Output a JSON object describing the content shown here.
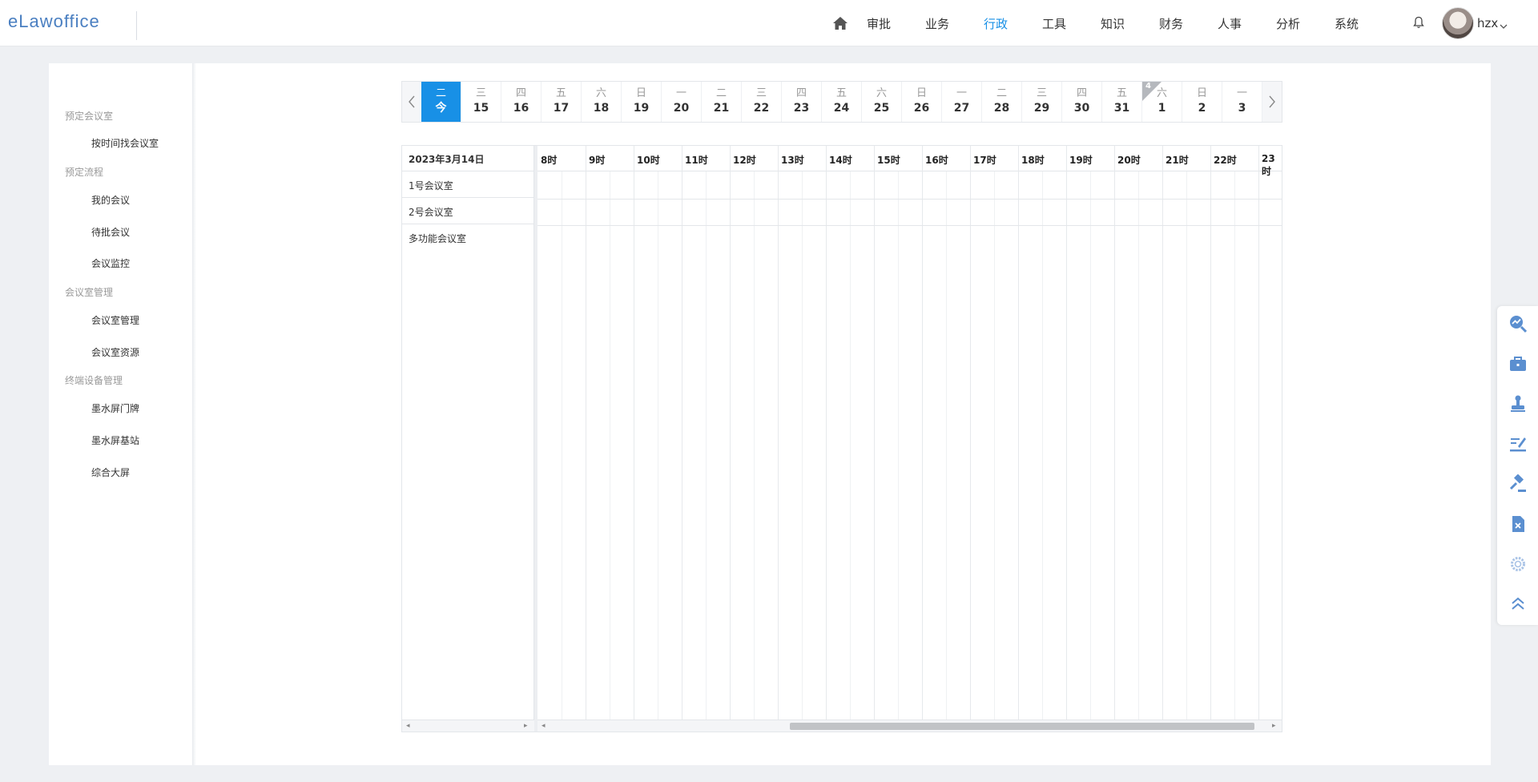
{
  "header": {
    "logo": "eLawoffice",
    "nav": [
      {
        "label": "审批"
      },
      {
        "label": "业务"
      },
      {
        "label": "行政",
        "active": true
      },
      {
        "label": "工具"
      },
      {
        "label": "知识"
      },
      {
        "label": "财务"
      },
      {
        "label": "人事"
      },
      {
        "label": "分析"
      },
      {
        "label": "系统"
      }
    ],
    "user": "hzx",
    "icons": [
      "home-icon",
      "bell-icon",
      "chevron-down-icon"
    ]
  },
  "sidebar": {
    "groups": [
      {
        "title": "预定会议室",
        "items": [
          "按时间找会议室"
        ]
      },
      {
        "title": "预定流程",
        "items": [
          "我的会议",
          "待批会议",
          "会议监控"
        ]
      },
      {
        "title": "会议室管理",
        "items": [
          "会议室管理",
          "会议室资源"
        ]
      },
      {
        "title": "终端设备管理",
        "items": [
          "墨水屏门牌",
          "墨水屏基站",
          "综合大屏"
        ]
      }
    ]
  },
  "date_strip": {
    "dates": [
      {
        "weekday": "二",
        "day": "今",
        "selected": true
      },
      {
        "weekday": "三",
        "day": "15"
      },
      {
        "weekday": "四",
        "day": "16"
      },
      {
        "weekday": "五",
        "day": "17"
      },
      {
        "weekday": "六",
        "day": "18"
      },
      {
        "weekday": "日",
        "day": "19"
      },
      {
        "weekday": "一",
        "day": "20"
      },
      {
        "weekday": "二",
        "day": "21"
      },
      {
        "weekday": "三",
        "day": "22"
      },
      {
        "weekday": "四",
        "day": "23"
      },
      {
        "weekday": "五",
        "day": "24"
      },
      {
        "weekday": "六",
        "day": "25"
      },
      {
        "weekday": "日",
        "day": "26"
      },
      {
        "weekday": "一",
        "day": "27"
      },
      {
        "weekday": "二",
        "day": "28"
      },
      {
        "weekday": "三",
        "day": "29"
      },
      {
        "weekday": "四",
        "day": "30"
      },
      {
        "weekday": "五",
        "day": "31"
      },
      {
        "weekday": "六",
        "day": "1",
        "month_tag": "4"
      },
      {
        "weekday": "日",
        "day": "2"
      },
      {
        "weekday": "一",
        "day": "3"
      }
    ]
  },
  "schedule": {
    "date_label": "2023年3月14日",
    "rooms": [
      "1号会议室",
      "2号会议室",
      "多功能会议室"
    ],
    "hours": [
      "8时",
      "9时",
      "10时",
      "11时",
      "12时",
      "13时",
      "14时",
      "15时",
      "16时",
      "17时",
      "18时",
      "19时",
      "20时",
      "21时",
      "22时",
      "23时"
    ]
  },
  "right_toolbar": {
    "icons": [
      "analytics-search-icon",
      "briefcase-icon",
      "stamp-icon",
      "sign-document-icon",
      "gavel-icon",
      "delete-file-icon",
      "settings-gear-icon",
      "scroll-top-icon"
    ]
  },
  "colors": {
    "accent": "#1890e6",
    "icon_blue": "#5b8fd0"
  }
}
